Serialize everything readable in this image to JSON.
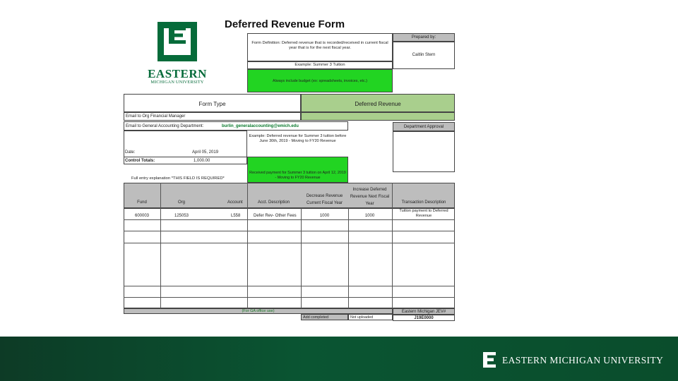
{
  "title": "Deferred Revenue Form",
  "logo": {
    "wordmark": "EASTERN",
    "subline": "MICHIGAN UNIVERSITY"
  },
  "definition": {
    "text": "Form Definition: Deferred revenue that is recorded/received in current fiscal year that is for the next fiscal year.",
    "example": "Example: Summer 3 Tuition",
    "note": "Always include budget (ex: spreadsheets, invoices, etc.)"
  },
  "prepared": {
    "label": "Prepared by:",
    "name": "Caitlin Stern"
  },
  "form_type": {
    "label": "Form Type",
    "value": "Deferred Revenue"
  },
  "email_org": "Email to Org Financial Manager",
  "email_gen": {
    "label": "Email to General Accounting Department:",
    "address": "burlin_generalaccounting@emich.edu"
  },
  "dept_approval": "Department Approval",
  "example_text": "Example: Deferred revenue for Summer 3 tuition before June 30th, 2019 - Moving to FY20 Revenue",
  "date": {
    "label": "Date:",
    "value": "April 05, 2019"
  },
  "control": {
    "label": "Control Totals:",
    "value": "1,000.00"
  },
  "explanation_label": "Full entry explanation *THIS FIELD IS REQUIRED*",
  "explanation_value": "Received payment for Summer 3 tuition on April 12, 2019 - Moving to FY20 Revenue",
  "table": {
    "headers": [
      "Fund",
      "Org",
      "Account",
      "Acct. Description",
      "Decrease Revenue Current Fiscal Year",
      "Increase Deferred Revenue Next Fiscal Year",
      "Transaction Description"
    ],
    "row": {
      "fund": "600003",
      "org": "125053",
      "account": "L558",
      "desc": "Defer Rev- Other Fees",
      "decrease": "1000",
      "increase": "1000",
      "trans": "Tuition payment to Deferred Revenue"
    }
  },
  "footer_row": {
    "note": "(For GA office use)",
    "jev_label": "Eastern Michigan JEV#",
    "jev_value": "J19E0000",
    "added": "Add completed",
    "uploaded": "Not uploaded"
  },
  "footer_brand": "EASTERN MICHIGAN UNIVERSITY",
  "colors": {
    "brand_green": "#066b3a",
    "highlight_green": "#22d422",
    "sage": "#a9cf8d",
    "grey": "#bdbdbd"
  }
}
